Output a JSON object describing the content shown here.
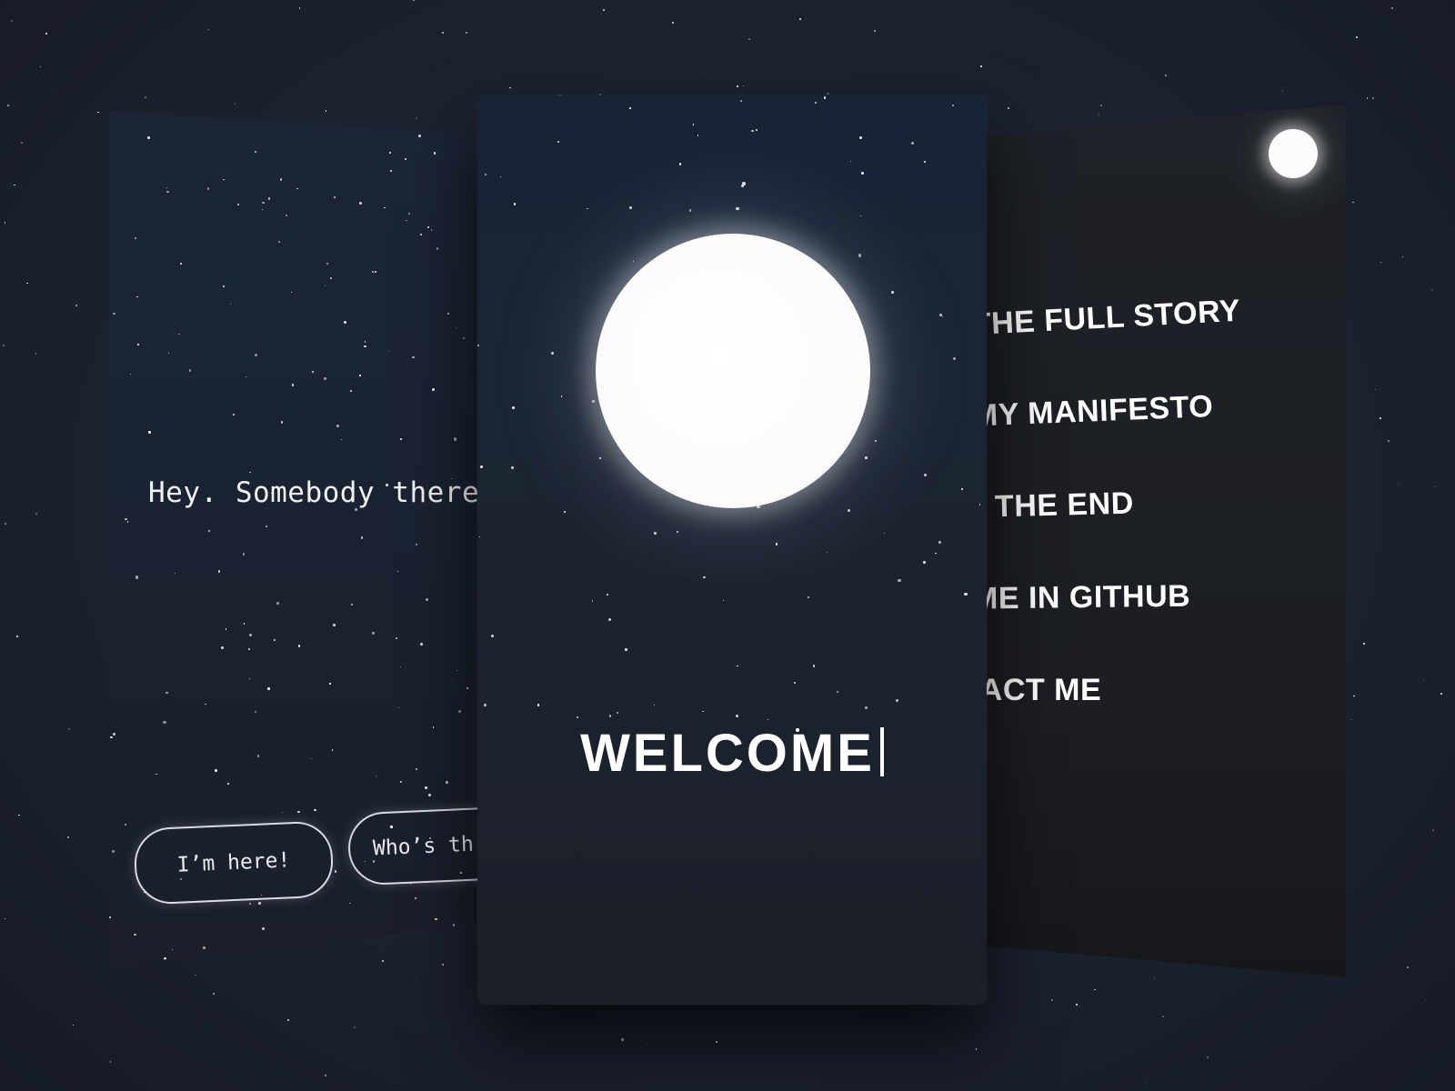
{
  "left_screen": {
    "prompt": "Hey. Somebody there",
    "buttons": [
      "I’m here!",
      "Who’s th"
    ]
  },
  "center_screen": {
    "title": "WELCOME"
  },
  "right_screen": {
    "menu": [
      "D THE FULL STORY",
      "D MY MANIFESTO",
      "CH THE END",
      "D ME IN GITHUB",
      "NTACT ME"
    ]
  },
  "colors": {
    "background": "#1c2230",
    "panel_left": "#1b2536",
    "panel_center": "#172436",
    "panel_right": "#1e2127",
    "moon": "#ffffff",
    "text": "#ffffff"
  },
  "icons": {
    "center_moon": "moon-icon",
    "right_moon": "small-moon-icon"
  }
}
